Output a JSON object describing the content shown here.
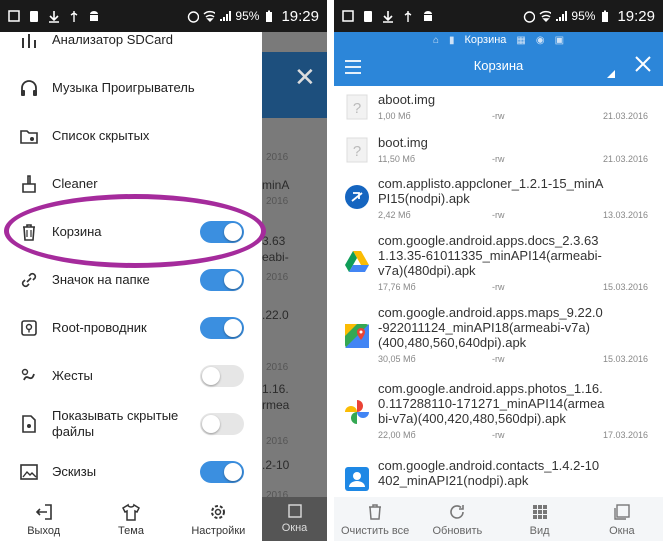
{
  "status_bar": {
    "battery": "95%",
    "time": "19:29"
  },
  "left_drawer": {
    "items": [
      {
        "label": "Анализатор SDCard",
        "toggle": null
      },
      {
        "label": "Музыка Проигрыватель",
        "toggle": null
      },
      {
        "label": "Список скрытых",
        "toggle": null
      },
      {
        "label": "Cleaner",
        "toggle": null
      },
      {
        "label": "Корзина",
        "toggle": "on"
      },
      {
        "label": "Значок на папке",
        "toggle": "on"
      },
      {
        "label": "Root-проводник",
        "toggle": "on"
      },
      {
        "label": "Жесты",
        "toggle": "off"
      },
      {
        "label": "Показывать скрытые файлы",
        "toggle": "off"
      },
      {
        "label": "Эскизы",
        "toggle": "on"
      }
    ],
    "bottom_bar": {
      "exit": "Выход",
      "theme": "Тема",
      "settings": "Настройки",
      "windows": "Окна"
    },
    "background_peek": {
      "dates": [
        "2016",
        "2016",
        "2016",
        "2016",
        "2016",
        "2016"
      ],
      "fragments": [
        "minA",
        "3.63",
        "eabi-",
        ".22.0",
        "1.16.",
        "rmea",
        ".2-10"
      ]
    }
  },
  "right_panel": {
    "tab_label": "Корзина",
    "title": "Корзина",
    "files": [
      {
        "name": "aboot.img",
        "size": "1,00 Мб",
        "perm": "-rw",
        "date": "21.03.2016",
        "icon": "unknown-file-icon"
      },
      {
        "name": "boot.img",
        "size": "11,50 Мб",
        "perm": "-rw",
        "date": "21.03.2016",
        "icon": "unknown-file-icon"
      },
      {
        "name": "com.applisto.appcloner_1.2.1-15_minAPI15(nodpi).apk",
        "size": "2,42 Мб",
        "perm": "-rw",
        "date": "13.03.2016",
        "icon": "appcloner-icon"
      },
      {
        "name": "com.google.android.apps.docs_2.3.631.13.35-61011335_minAPI14(armeabi-v7a)(480dpi).apk",
        "size": "17,76 Мб",
        "perm": "-rw",
        "date": "15.03.2016",
        "icon": "google-drive-icon"
      },
      {
        "name": "com.google.android.apps.maps_9.22.0-922011124_minAPI18(armeabi-v7a)(400,480,560,640dpi).apk",
        "size": "30,05 Мб",
        "perm": "-rw",
        "date": "15.03.2016",
        "icon": "google-maps-icon"
      },
      {
        "name": "com.google.android.apps.photos_1.16.0.117288110-171271_minAPI14(armeabi-v7a)(400,420,480,560dpi).apk",
        "size": "22,00 Мб",
        "perm": "-rw",
        "date": "17.03.2016",
        "icon": "google-photos-icon"
      },
      {
        "name": "com.google.android.contacts_1.4.2-10402_minAPI21(nodpi).apk",
        "size": "",
        "perm": "",
        "date": "",
        "icon": "contacts-icon"
      }
    ],
    "name_lines": [
      [
        "aboot.img"
      ],
      [
        "boot.img"
      ],
      [
        "com.applisto.appcloner_1.2.1-15_minA",
        "PI15(nodpi).apk"
      ],
      [
        "com.google.android.apps.docs_2.3.63",
        "1.13.35-61011335_minAPI14(armeabi-",
        "v7a)(480dpi).apk"
      ],
      [
        "com.google.android.apps.maps_9.22.0",
        "-922011124_minAPI18(armeabi-v7a)",
        "(400,480,560,640dpi).apk"
      ],
      [
        "com.google.android.apps.photos_1.16.",
        "0.117288110-171271_minAPI14(armea",
        "bi-v7a)(400,420,480,560dpi).apk"
      ],
      [
        "com.google.android.contacts_1.4.2-10",
        "402_minAPI21(nodpi).apk"
      ]
    ],
    "bottom_bar": {
      "clear": "Очистить все",
      "refresh": "Обновить",
      "view": "Вид",
      "windows": "Окна"
    }
  },
  "colors": {
    "accent_blue": "#2c86d9",
    "toggle_on": "#3b8fe0",
    "highlight": "#a52b9c"
  }
}
